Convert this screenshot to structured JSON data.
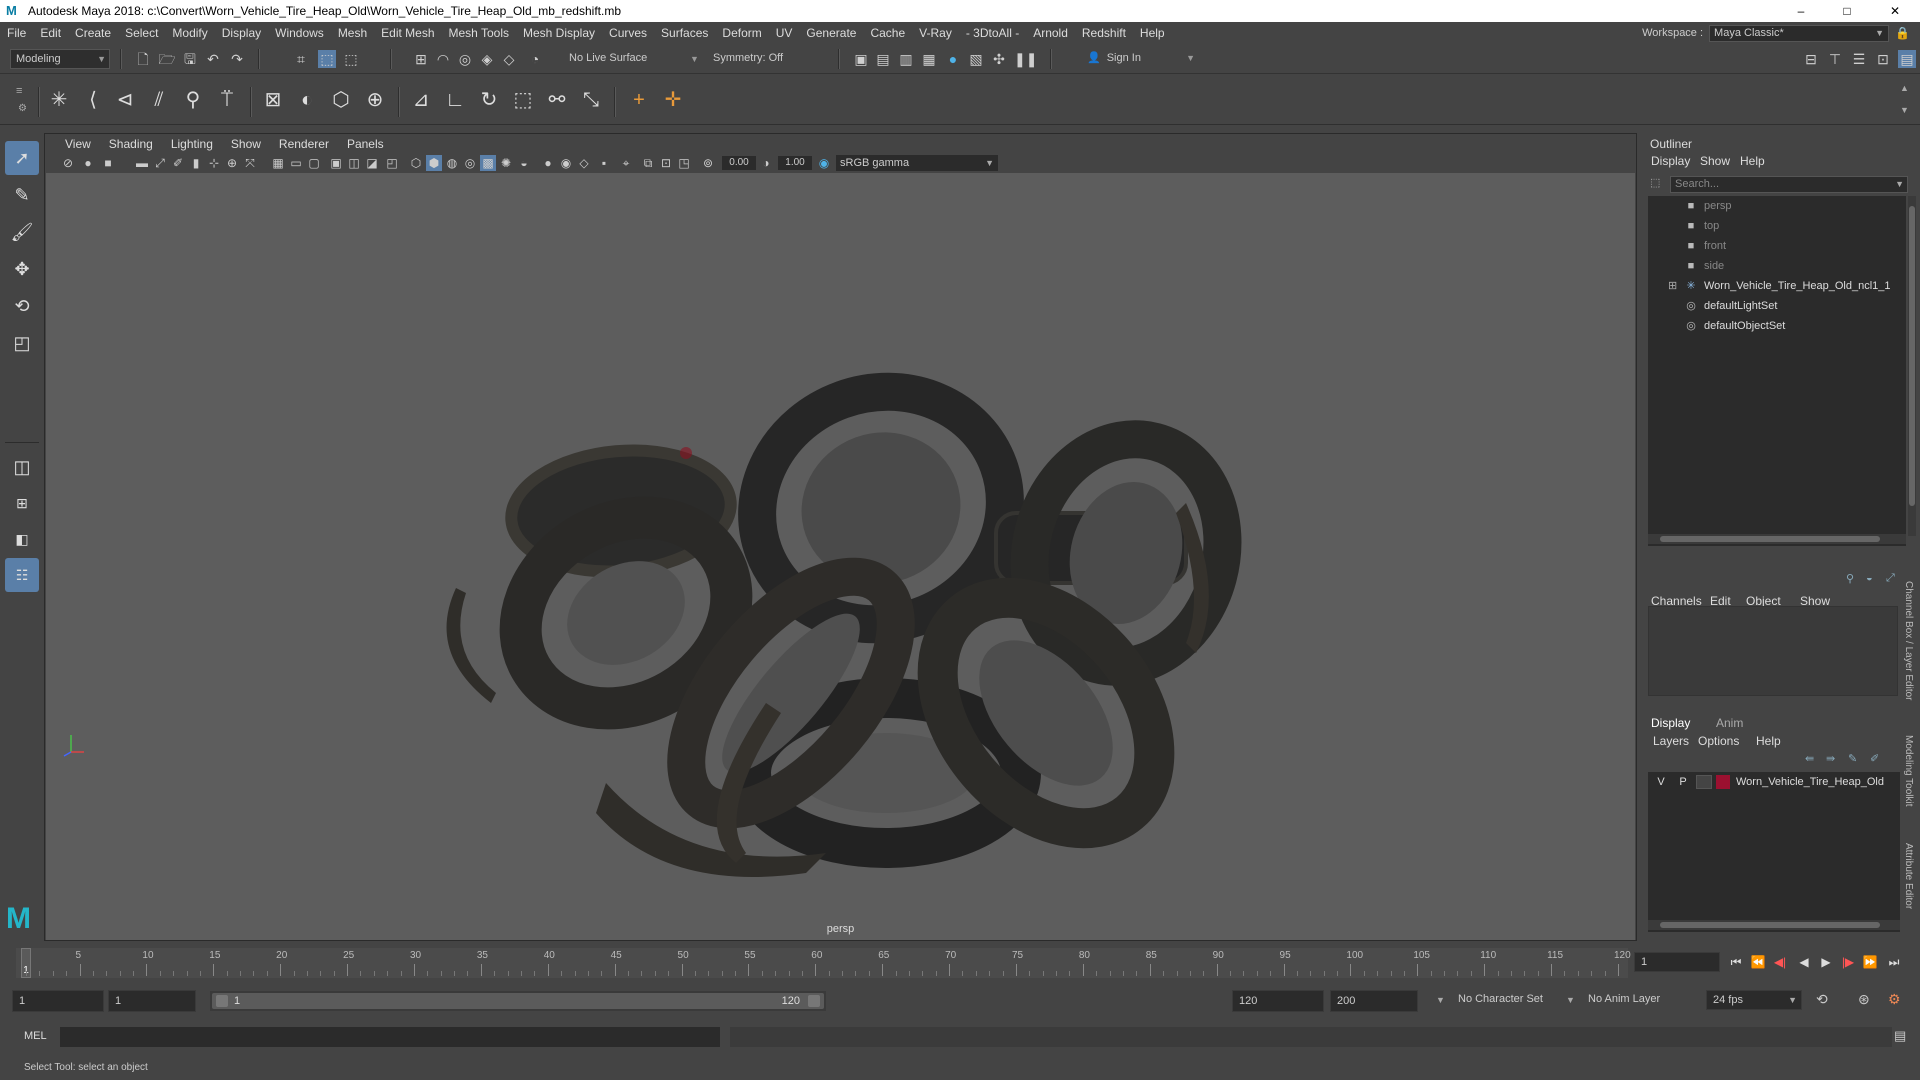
{
  "window": {
    "title": "Autodesk Maya 2018: c:\\Convert\\Worn_Vehicle_Tire_Heap_Old\\Worn_Vehicle_Tire_Heap_Old_mb_redshift.mb",
    "logo": "M",
    "minimize": "–",
    "maximize": "□",
    "close": "✕"
  },
  "menubar": {
    "items": [
      "File",
      "Edit",
      "Create",
      "Select",
      "Modify",
      "Display",
      "Windows",
      "Mesh",
      "Edit Mesh",
      "Mesh Tools",
      "Mesh Display",
      "Curves",
      "Surfaces",
      "Deform",
      "UV",
      "Generate",
      "Cache",
      "V-Ray",
      "- 3DtoAll -",
      "Arnold",
      "Redshift",
      "Help"
    ],
    "workspace_label": "Workspace :",
    "workspace_value": "Maya Classic*"
  },
  "statusline": {
    "mode": "Modeling",
    "live_surface": "No Live Surface",
    "symmetry": "Symmetry: Off",
    "sign_in": "Sign In"
  },
  "viewport": {
    "menu": [
      "View",
      "Shading",
      "Lighting",
      "Show",
      "Renderer",
      "Panels"
    ],
    "exposure": "0.00",
    "gamma": "1.00",
    "color_space": "sRGB gamma",
    "camera_label": "persp"
  },
  "outliner": {
    "title": "Outliner",
    "menu": [
      "Display",
      "Show",
      "Help"
    ],
    "search_placeholder": "Search...",
    "items": [
      {
        "label": "persp",
        "icon": "camera-icon",
        "dim": true
      },
      {
        "label": "top",
        "icon": "camera-icon",
        "dim": true
      },
      {
        "label": "front",
        "icon": "camera-icon",
        "dim": true
      },
      {
        "label": "side",
        "icon": "camera-icon",
        "dim": true
      },
      {
        "label": "Worn_Vehicle_Tire_Heap_Old_ncl1_1",
        "icon": "group-icon",
        "dim": false,
        "expandable": true
      },
      {
        "label": "defaultLightSet",
        "icon": "set-icon",
        "dim": false
      },
      {
        "label": "defaultObjectSet",
        "icon": "set-icon",
        "dim": false
      }
    ]
  },
  "channelbox": {
    "menu": [
      "Channels",
      "Edit",
      "Object",
      "Show"
    ]
  },
  "layer_editor": {
    "tabs": [
      "Display",
      "Anim"
    ],
    "menu": [
      "Layers",
      "Options",
      "Help"
    ],
    "layer": {
      "v": "V",
      "p": "P",
      "name": "Worn_Vehicle_Tire_Heap_Old",
      "color": "#9b1030"
    }
  },
  "side_tabs": [
    "Channel Box / Layer Editor",
    "Modeling Toolkit",
    "Attribute Editor"
  ],
  "timeslider": {
    "ticks": [
      "5",
      "10",
      "15",
      "20",
      "25",
      "30",
      "35",
      "40",
      "45",
      "50",
      "55",
      "60",
      "65",
      "70",
      "75",
      "80",
      "85",
      "90",
      "95",
      "100",
      "105",
      "110",
      "115",
      "120"
    ],
    "current_frame_marker": "1",
    "current_frame_field": "1"
  },
  "rangebar": {
    "start": "1",
    "start_inner": "1",
    "range_start": "1",
    "range_end": "120",
    "end_inner": "120",
    "end": "200",
    "character_set": "No Character Set",
    "anim_layer": "No Anim Layer",
    "fps": "24 fps"
  },
  "cmdline": {
    "label": "MEL"
  },
  "helpline": {
    "text": "Select Tool: select an object"
  }
}
